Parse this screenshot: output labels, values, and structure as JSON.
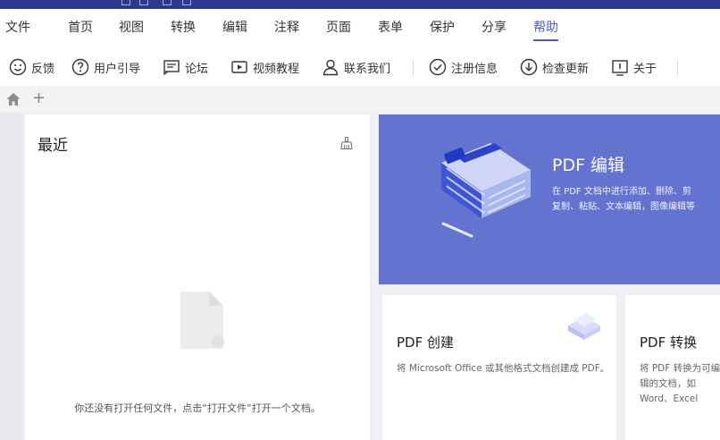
{
  "menu": {
    "items": [
      "文件",
      "首页",
      "视图",
      "转换",
      "编辑",
      "注释",
      "页面",
      "表单",
      "保护",
      "分享",
      "帮助"
    ],
    "active_index": 10
  },
  "toolbar": {
    "tools": [
      {
        "label": "反馈",
        "icon": "smiley-icon"
      },
      {
        "label": "用户引导",
        "icon": "question-circle-icon"
      },
      {
        "label": "论坛",
        "icon": "forum-icon"
      },
      {
        "label": "视频教程",
        "icon": "play-video-icon"
      },
      {
        "label": "联系我们",
        "icon": "contact-person-icon"
      },
      {
        "label": "注册信息",
        "icon": "register-check-icon"
      },
      {
        "label": "检查更新",
        "icon": "download-update-icon"
      },
      {
        "label": "关于",
        "icon": "info-box-icon"
      }
    ]
  },
  "tabbar": {
    "add_label": "+"
  },
  "recent": {
    "title": "最近",
    "empty_message": "你还没有打开任何文件，点击“打开文件”打开一个文档。"
  },
  "banner": {
    "title": "PDF 编辑",
    "desc_line1": "在 PDF 文档中进行添加、删除、剪",
    "desc_line2": "复制、粘贴、文本编辑，图像编辑等"
  },
  "cards": [
    {
      "title": "PDF 创建",
      "desc": "将 Microsoft Office 或其他格式文档创建成 PDF。"
    },
    {
      "title": "PDF 转换",
      "desc": "将 PDF 转换为可编辑的文档，如 Word、Excel"
    }
  ],
  "colors": {
    "accent": "#4a5bd4",
    "banner": "#6573d0",
    "titlebar": "#2b3990"
  }
}
